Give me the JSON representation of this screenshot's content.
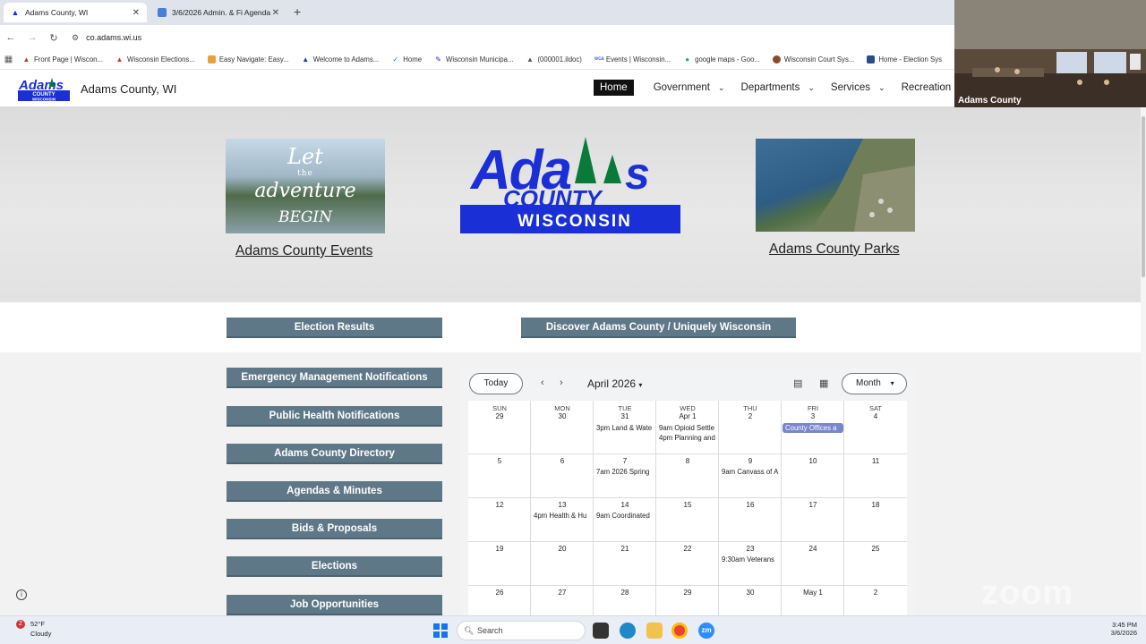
{
  "browser": {
    "tabs": [
      {
        "title": "Adams County, WI",
        "active": true
      },
      {
        "title": "3/6/2026 Admin. & Fi Agenda -",
        "active": false
      }
    ],
    "url": "co.adams.wi.us",
    "bookmarks": [
      "Front Page | Wiscon...",
      "Wisconsin Elections...",
      "Easy Navigate: Easy...",
      "Welcome to Adams...",
      "Home",
      "Wisconsin Municipa...",
      "(000001.ildoc)",
      "Events | Wisconsin...",
      "google maps - Goo...",
      "Wisconsin Court Sys...",
      "Home - Election Sys"
    ]
  },
  "site": {
    "title": "Adams County, WI",
    "nav": [
      "Home",
      "Government",
      "Departments",
      "Services",
      "Recreation"
    ],
    "logo": {
      "line1": "Adams",
      "line2": "COUNTY",
      "line3": "WISCONSIN"
    },
    "hero": {
      "left_image_text": [
        "Let",
        "the",
        "adventure",
        "BEGIN"
      ],
      "left_link": "Adams County Events",
      "right_link": "Adams County Parks"
    },
    "buttons": {
      "election_results": "Election Results",
      "discover": "Discover Adams County / Uniquely Wisconsin",
      "sidebar": [
        "Emergency Management Notifications",
        "Public Health Notifications",
        "Adams County Directory",
        "Agendas & Minutes",
        "Bids & Proposals",
        "Elections",
        "Job Opportunities"
      ]
    },
    "colors": {
      "button": "#5f7888",
      "brand_blue": "#1a2fd6",
      "tree_green": "#0a7a3a"
    }
  },
  "calendar": {
    "today_label": "Today",
    "month_label": "April 2026",
    "view_label": "Month",
    "weekdays": [
      "SUN",
      "MON",
      "TUE",
      "WED",
      "THU",
      "FRI",
      "SAT"
    ],
    "weeks": [
      [
        "29",
        "30",
        "31",
        "Apr 1",
        "2",
        "3",
        "4"
      ],
      [
        "5",
        "6",
        "7",
        "8",
        "9",
        "10",
        "11"
      ],
      [
        "12",
        "13",
        "14",
        "15",
        "16",
        "17",
        "18"
      ],
      [
        "19",
        "20",
        "21",
        "22",
        "23",
        "24",
        "25"
      ],
      [
        "26",
        "27",
        "28",
        "29",
        "30",
        "May 1",
        "2"
      ]
    ],
    "events": {
      "w0_tue": "3pm Land & Wate",
      "w0_wed_1": "9am Opioid Settle",
      "w0_wed_2": "4pm Planning and",
      "w0_fri": "County Offices a",
      "w1_tue": "7am 2026 Spring",
      "w1_thu": "9am Canvass of A",
      "w2_mon": "4pm Health & Hu",
      "w2_tue": "9am Coordinated",
      "w3_thu": "9:30am Veterans"
    }
  },
  "zoom": {
    "participant": "Adams County",
    "watermark": "zoom"
  },
  "taskbar": {
    "weather_temp": "52°F",
    "weather_desc": "Cloudy",
    "notif_count": "2",
    "search_placeholder": "Search",
    "time": "3:45 PM",
    "date": "3/6/2026"
  }
}
